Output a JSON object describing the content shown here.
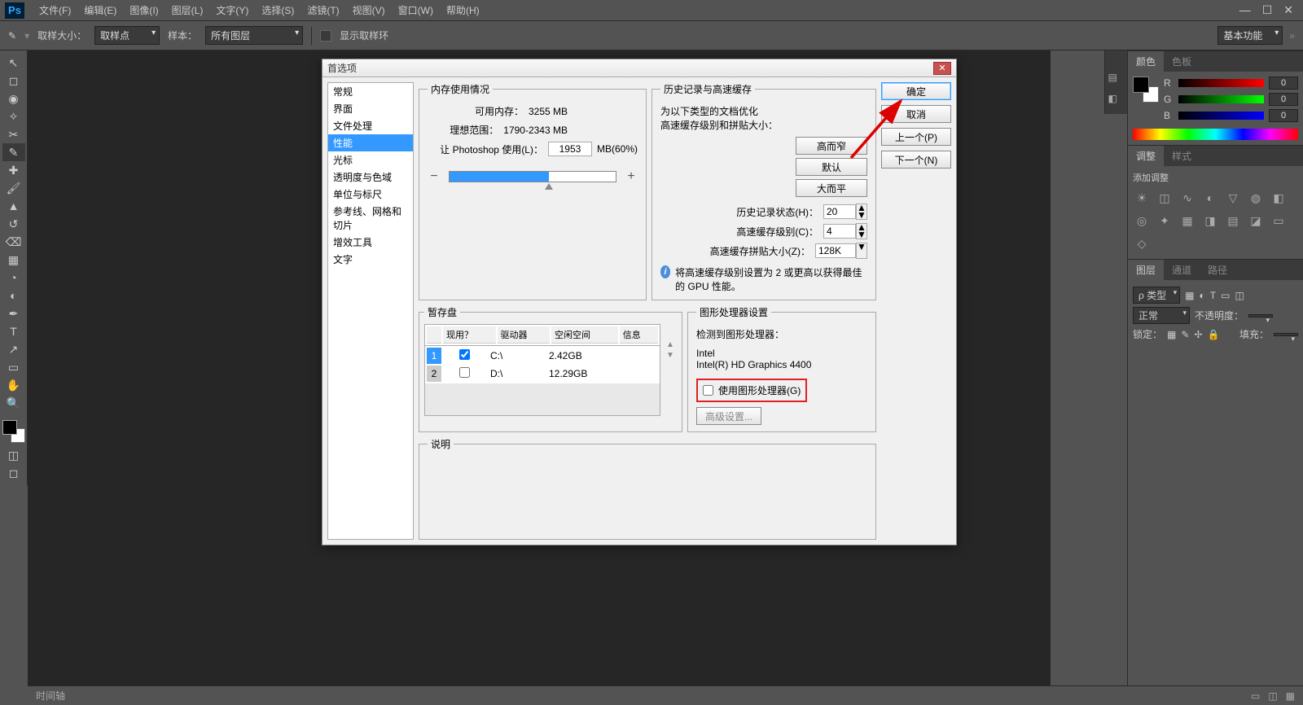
{
  "menubar": {
    "items": [
      "文件(F)",
      "编辑(E)",
      "图像(I)",
      "图层(L)",
      "文字(Y)",
      "选择(S)",
      "滤镜(T)",
      "视图(V)",
      "窗口(W)",
      "帮助(H)"
    ]
  },
  "optbar": {
    "sample_size_label": "取样大小：",
    "sample_size_value": "取样点",
    "sample_label": "样本：",
    "sample_value": "所有图层",
    "show_ring_label": "显示取样环",
    "workspace_label": "基本功能"
  },
  "right_panels": {
    "color_tab": "颜色",
    "swatches_tab": "色板",
    "r": "R",
    "g": "G",
    "b": "B",
    "r_val": "0",
    "g_val": "0",
    "b_val": "0",
    "adjust_tab": "调整",
    "styles_tab": "样式",
    "adjust_label": "添加调整",
    "layers_tab": "图层",
    "channels_tab": "通道",
    "paths_tab": "路径",
    "kind_label": "ρ 类型",
    "blend_label": "正常",
    "opacity_label": "不透明度：",
    "lock_label": "锁定：",
    "fill_label": "填充："
  },
  "statusbar": {
    "timeline": "时间轴"
  },
  "dialog": {
    "title": "首选项",
    "nav": [
      "常规",
      "界面",
      "文件处理",
      "性能",
      "光标",
      "透明度与色域",
      "单位与标尺",
      "参考线、网格和切片",
      "增效工具",
      "文字"
    ],
    "nav_selected": 3,
    "buttons": {
      "ok": "确定",
      "cancel": "取消",
      "prev": "上一个(P)",
      "next": "下一个(N)"
    },
    "memory": {
      "legend": "内存使用情况",
      "avail_label": "可用内存：",
      "avail_value": "3255 MB",
      "ideal_label": "理想范围：",
      "ideal_value": "1790-2343 MB",
      "let_label": "让 Photoshop 使用(L)：",
      "let_value": "1953",
      "let_suffix": "MB(60%)",
      "slider_pct": 60
    },
    "history": {
      "legend": "历史记录与高速缓存",
      "opt_line1": "为以下类型的文档优化",
      "opt_line2": "高速缓存级别和拼贴大小：",
      "btn_tall": "高而窄",
      "btn_default": "默认",
      "btn_wide": "大而平",
      "states_label": "历史记录状态(H)：",
      "states_value": "20",
      "levels_label": "高速缓存级别(C)：",
      "levels_value": "4",
      "tile_label": "高速缓存拼贴大小(Z)：",
      "tile_value": "128K",
      "note": "将高速缓存级别设置为 2 或更高以获得最佳的 GPU 性能。"
    },
    "scratch": {
      "legend": "暂存盘",
      "col_active": "现用？",
      "col_drive": "驱动器",
      "col_free": "空闲空间",
      "col_info": "信息",
      "row1": {
        "n": "1",
        "drive": "C:\\",
        "free": "2.42GB"
      },
      "row2": {
        "n": "2",
        "drive": "D:\\",
        "free": "12.29GB"
      }
    },
    "gpu": {
      "legend": "图形处理器设置",
      "detected_label": "检测到图形处理器：",
      "vendor": "Intel",
      "model": "Intel(R) HD Graphics 4400",
      "use_label": "使用图形处理器(G)",
      "advanced": "高级设置..."
    },
    "desc": {
      "legend": "说明"
    }
  }
}
